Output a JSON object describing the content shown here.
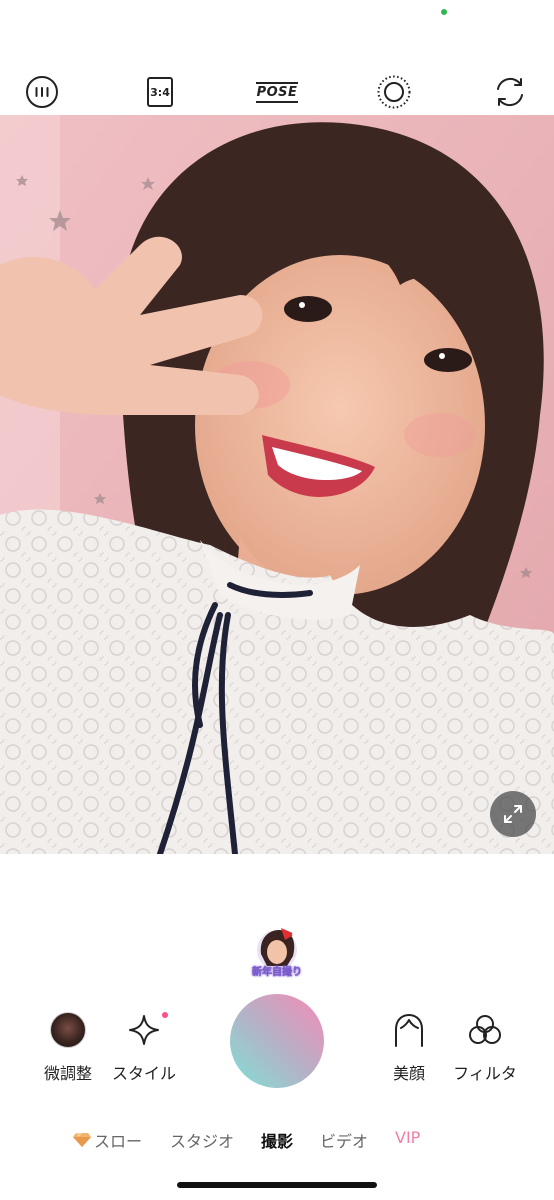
{
  "toolbar": {
    "ratio_label": "3:4",
    "pose_label": "POSE"
  },
  "sticker": {
    "label": "新年自撮り"
  },
  "controls": {
    "fine_tune": "微調整",
    "style": "スタイル",
    "beauty": "美顔",
    "filter": "フィルタ"
  },
  "modes": {
    "slow": "スロー",
    "studio": "スタジオ",
    "photo": "撮影",
    "video": "ビデオ",
    "vip": "VIP",
    "selected": "撮影"
  },
  "colors": {
    "accent_pink": "#f47fa3",
    "shutter_start": "#f58bb6",
    "shutter_end": "#7fe0d5",
    "status_dot": "#2fb84f"
  }
}
